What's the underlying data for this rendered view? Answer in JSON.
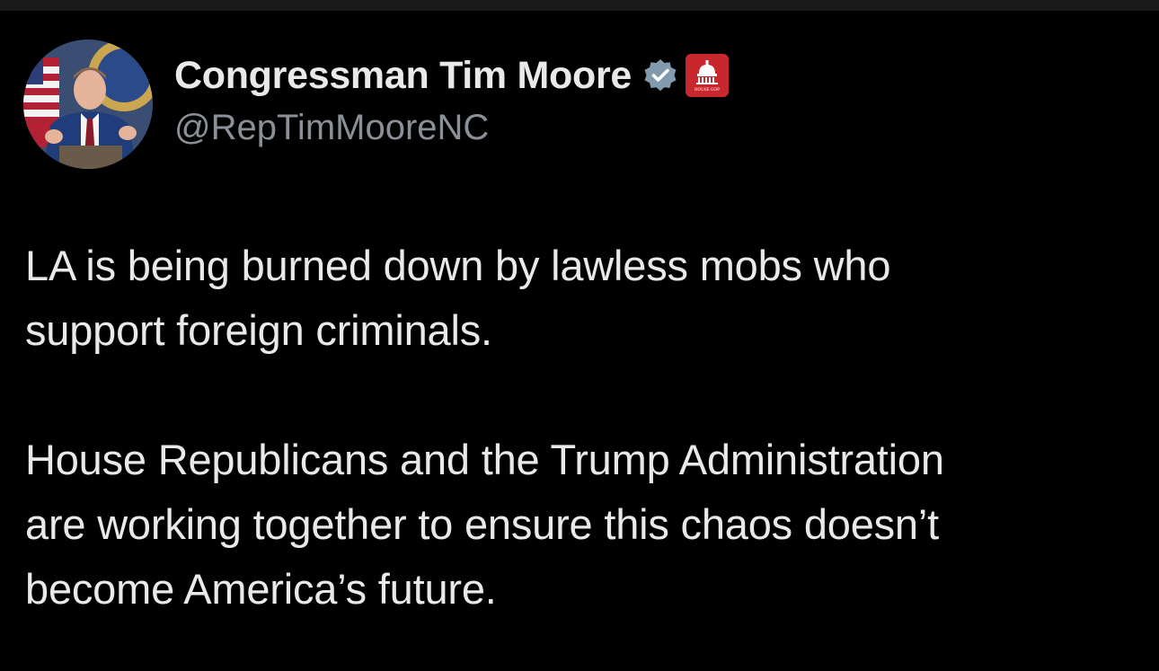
{
  "tweet": {
    "author": {
      "display_name": "Congressman Tim Moore",
      "handle": "@RepTimMooreNC",
      "verified_icon": "verified-badge-icon",
      "affiliate_badge": "house-gop-badge-icon",
      "affiliate_badge_text": "HOUSE GOP",
      "avatar": "avatar-photo"
    },
    "body": {
      "paragraph_1_line_1": "LA is being burned down by lawless mobs who",
      "paragraph_1_line_2": "support foreign criminals.",
      "paragraph_2_line_1": "House Republicans and the Trump Administration",
      "paragraph_2_line_2": "are working together to ensure this chaos doesn’t",
      "paragraph_2_line_3": "become America’s future."
    }
  },
  "colors": {
    "background": "#000000",
    "primary_text": "#e7e9ea",
    "secondary_text": "#8b9096",
    "verified_badge": "#829aab",
    "affiliate_badge": "#c8282d"
  }
}
